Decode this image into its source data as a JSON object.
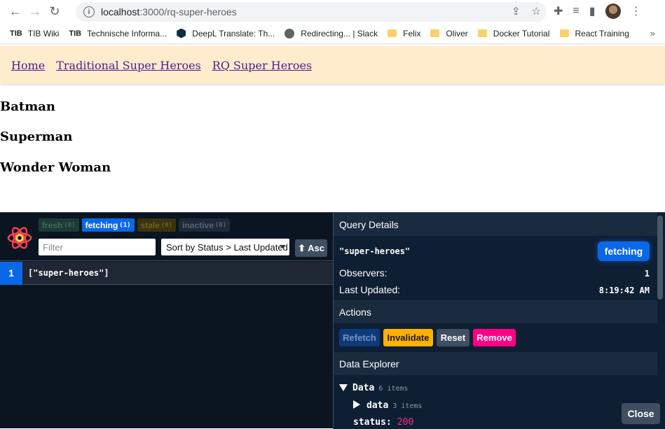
{
  "browser": {
    "url_host": "localhost",
    "url_path": ":3000/rq-super-heroes",
    "bookmarks": [
      {
        "label": "TIB Wiki",
        "icon": "tib-icon"
      },
      {
        "label": "Technische Informa...",
        "icon": "tib-icon"
      },
      {
        "label": "DeepL Translate: Th...",
        "icon": "deepl-icon"
      },
      {
        "label": "Redirecting... | Slack",
        "icon": "globe-icon"
      },
      {
        "label": "Felix",
        "icon": "folder-icon"
      },
      {
        "label": "Oliver",
        "icon": "folder-icon"
      },
      {
        "label": "Docker Tutorial",
        "icon": "folder-icon"
      },
      {
        "label": "React Training",
        "icon": "folder-icon"
      }
    ],
    "tib_mark": "TIB",
    "more": "»"
  },
  "nav": {
    "links": [
      "Home",
      "Traditional Super Heroes",
      "RQ Super Heroes"
    ]
  },
  "heroes": [
    "Batman",
    "Superman",
    "Wonder Woman"
  ],
  "devtools": {
    "badges": [
      {
        "label": "fresh",
        "count": "(0)"
      },
      {
        "label": "fetching",
        "count": "(1)"
      },
      {
        "label": "stale",
        "count": "(0)"
      },
      {
        "label": "inactive",
        "count": "(0)"
      }
    ],
    "filter_placeholder": "Filter",
    "sort_label": "Sort by Status > Last Updated",
    "asc_label": "⬆ Asc",
    "query": {
      "observers_count": "1",
      "key": "[\"super-heroes\"]"
    },
    "details": {
      "title": "Query Details",
      "key": "\"super-heroes\"",
      "status": "fetching",
      "observers_label": "Observers:",
      "observers_value": "1",
      "updated_label": "Last Updated:",
      "updated_value": "8:19:42 AM"
    },
    "actions": {
      "title": "Actions",
      "refetch": "Refetch",
      "invalidate": "Invalidate",
      "reset": "Reset",
      "remove": "Remove"
    },
    "explorer": {
      "title": "Data Explorer",
      "root_label": "Data",
      "root_count": "6 items",
      "child_label": "data",
      "child_count": "3 items",
      "status_label": "status:",
      "status_value": "200"
    },
    "close": "Close"
  },
  "colors": {
    "nav_bg": "#ffeccd",
    "link": "#551a8b",
    "fetching": "#0b67e9",
    "invalidate": "#ffb200",
    "remove": "#ff0085"
  }
}
